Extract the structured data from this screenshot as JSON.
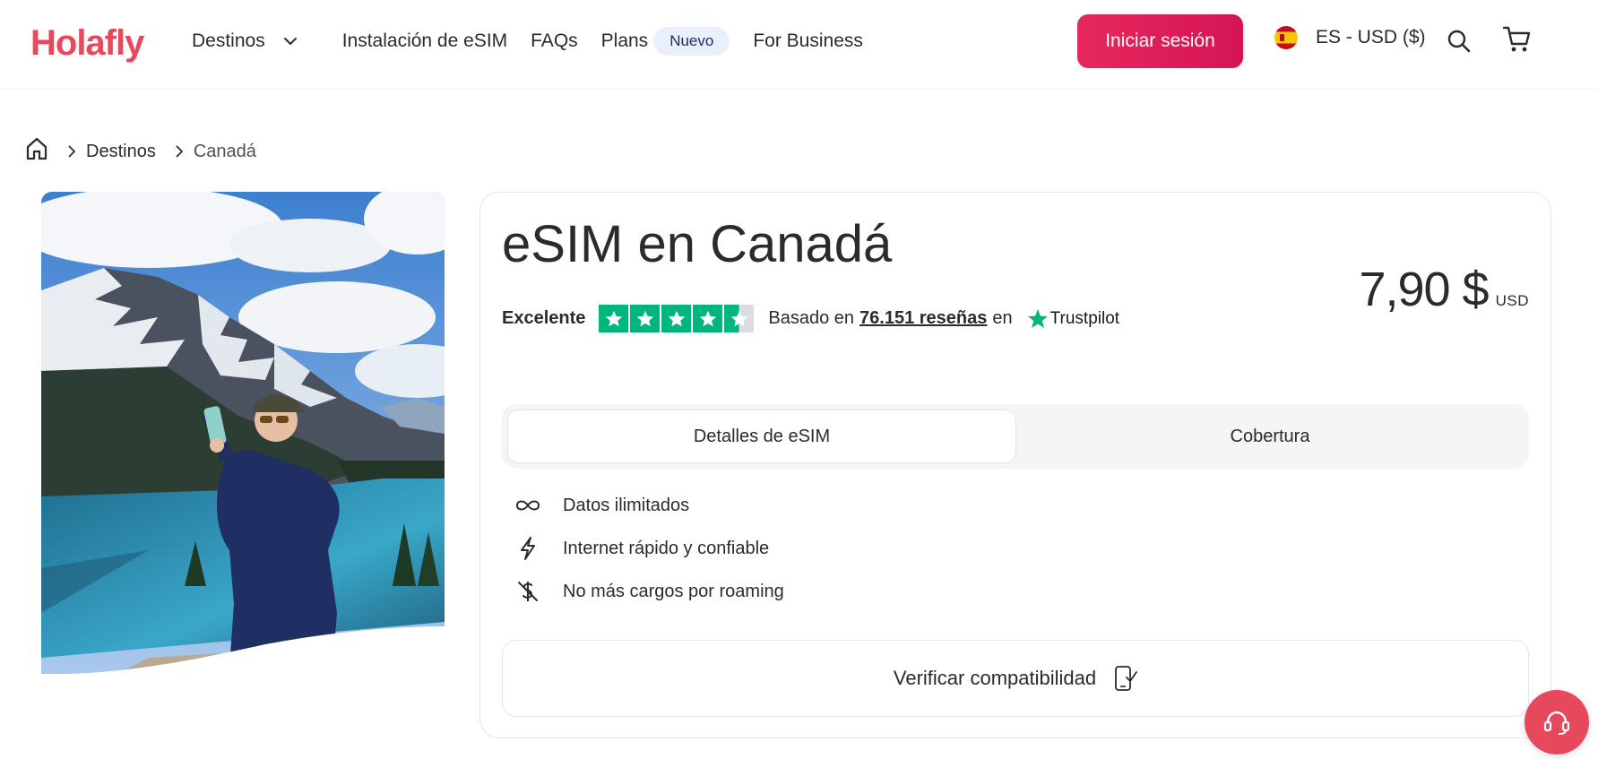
{
  "header": {
    "logo_text": "Holafly",
    "nav": {
      "destinos": "Destinos",
      "install": "Instalación de eSIM",
      "faqs": "FAQs",
      "plans": "Plans",
      "plans_badge": "Nuevo",
      "business": "For Business"
    },
    "login_label": "Iniciar sesión",
    "locale_label": "ES - USD ($)",
    "icons": {
      "chevron": "chevron-down-icon",
      "search": "search-icon",
      "cart": "cart-icon",
      "flag": "spain-flag-icon"
    }
  },
  "breadcrumb": {
    "home_icon": "home-icon",
    "items": [
      "Destinos",
      "Canadá"
    ]
  },
  "product": {
    "title": "eSIM en Canadá",
    "price_value": "7,90 $",
    "price_currency": "USD",
    "rating": {
      "label": "Excelente",
      "stars_value": 4.5,
      "stars_max": 5,
      "based_on": "Basado en",
      "reviews_count": "76.151 reseñas",
      "in": "en",
      "provider": "Trustpilot"
    },
    "tabs": [
      {
        "label": "Detalles de eSIM",
        "active": true
      },
      {
        "label": "Cobertura",
        "active": false
      }
    ],
    "features": [
      {
        "icon": "infinity-icon",
        "text": "Datos ilimitados"
      },
      {
        "icon": "lightning-icon",
        "text": "Internet rápido y confiable"
      },
      {
        "icon": "no-dollar-icon",
        "text": "No más cargos por roaming"
      }
    ],
    "compat_label": "Verificar compatibilidad"
  },
  "colors": {
    "brand": "#e6485c",
    "login_button": "#e01e5a",
    "trustpilot_green": "#00b67a",
    "text": "#292b2e"
  },
  "help_icon": "support-headset-icon"
}
